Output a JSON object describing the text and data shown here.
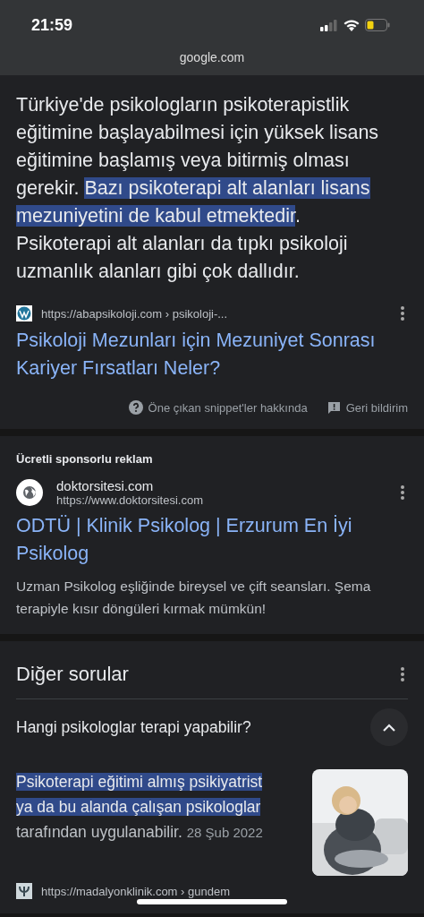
{
  "status_bar": {
    "time": "21:59"
  },
  "address_bar": {
    "domain": "google.com"
  },
  "snippet": {
    "paragraph": [
      {
        "text": "Türkiye'de psikologların psikoterapistlik eğitimine başlayabilmesi için yüksek lisans eğitimine başlamış veya bitirmiş olması gerekir. ",
        "highlighted": false
      },
      {
        "text": "Bazı psikoterapi alt alanları lisans mezuniyetini de kabul etmektedir",
        "highlighted": true
      },
      {
        "text": ". Psikoterapi alt alanları da tıpkı psikoloji uzmanlık alanları gibi çok dallıdır.",
        "highlighted": false
      }
    ],
    "source_url": "https://abapsikoloji.com › psikoloji-...",
    "title": "Psikoloji Mezunları için Mezuniyet Sonrası Kariyer Fırsatları Neler?",
    "about_link": "Öne çıkan snippet'ler hakkında",
    "feedback_link": "Geri bildirim"
  },
  "ad": {
    "label": "Ücretli sponsorlu reklam",
    "site": "doktorsitesi.com",
    "url": "https://www.doktorsitesi.com",
    "title": "ODTÜ | Klinik Psikolog | Erzurum En İyi Psikolog",
    "description": "Uzman Psikolog eşliğinde bireysel ve çift seansları. Şema terapiyle kısır döngüleri kırmak mümkün!"
  },
  "related_questions": {
    "heading": "Diğer sorular",
    "items": [
      {
        "question": "Hangi psikologlar terapi yapabilir?",
        "expanded": true,
        "answer": [
          {
            "text": "Psikoterapi eğitimi almış psikiyatrist ya da bu alanda çalışan psikologlar",
            "highlighted": true
          },
          {
            "text": " tarafından uygulanabilir.",
            "highlighted": false
          }
        ],
        "date": "28 Şub 2022",
        "source_url": "https://madalyonklinik.com › gundem"
      }
    ]
  }
}
